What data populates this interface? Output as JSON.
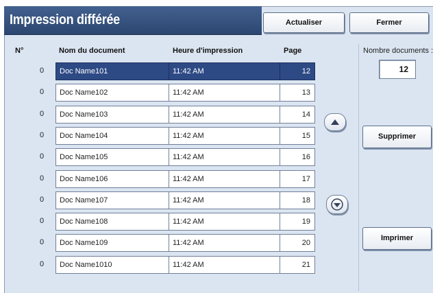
{
  "header": {
    "title": "Impression différée",
    "refresh_label": "Actualiser",
    "close_label": "Fermer"
  },
  "columns": {
    "number": "N°",
    "document_name": "Nom du document",
    "print_time": "Heure d'impression",
    "page": "Page"
  },
  "rows": [
    {
      "number": "0",
      "name": "Doc Name101",
      "time": "11:42 AM",
      "page": "12",
      "selected": true
    },
    {
      "number": "0",
      "name": "Doc Name102",
      "time": "11:42 AM",
      "page": "13"
    },
    {
      "number": "0",
      "name": "Doc Name103",
      "time": "11:42 AM",
      "page": "14"
    },
    {
      "number": "0",
      "name": "Doc Name104",
      "time": "11:42 AM",
      "page": "15"
    },
    {
      "number": "0",
      "name": "Doc Name105",
      "time": "11:42 AM",
      "page": "16"
    },
    {
      "number": "0",
      "name": "Doc Name106",
      "time": "11:42 AM",
      "page": "17"
    },
    {
      "number": "0",
      "name": "Doc Name107",
      "time": "11:42 AM",
      "page": "18"
    },
    {
      "number": "0",
      "name": "Doc Name108",
      "time": "11:42 AM",
      "page": "19"
    },
    {
      "number": "0",
      "name": "Doc Name109",
      "time": "11:42 AM",
      "page": "20"
    },
    {
      "number": "0",
      "name": "Doc Name1010",
      "time": "11:42 AM",
      "page": "21"
    }
  ],
  "side": {
    "count_label": "Nombre documents :",
    "count_value": "12",
    "delete_label": "Supprimer",
    "print_label": "Imprimer"
  },
  "icons": {
    "scroll_up": "triangle-up-icon",
    "scroll_down": "chevron-down-icon"
  },
  "colors": {
    "title_bar": "#2c4670",
    "selected_row": "#2e4a85",
    "panel_background": "#dbe5f1"
  }
}
